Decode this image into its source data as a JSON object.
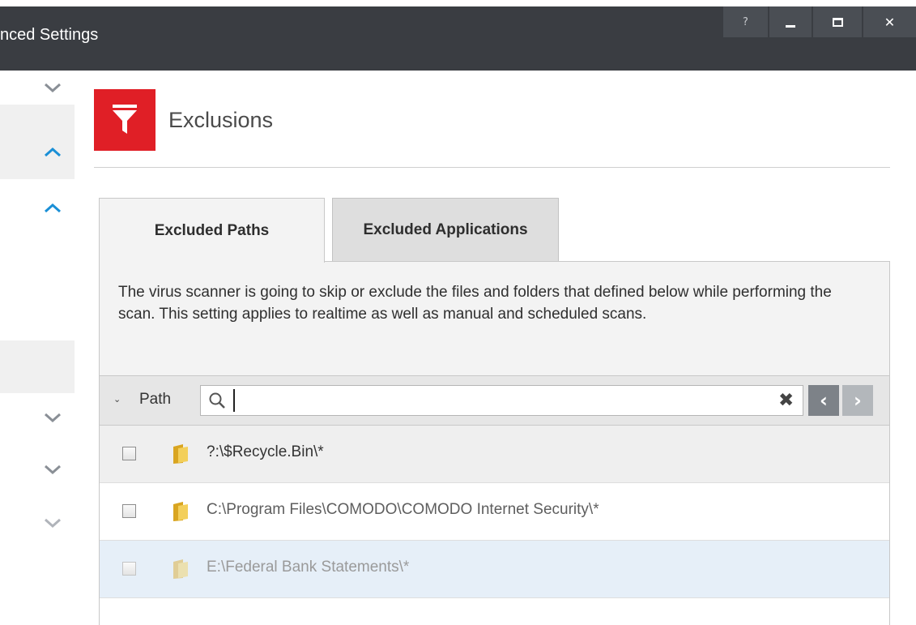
{
  "window": {
    "title": "nced Settings",
    "controls": {
      "help": "?",
      "close": "✕"
    }
  },
  "header": {
    "title": "Exclusions",
    "icon": "filter-icon",
    "accent_color": "#e01f26"
  },
  "tabs": [
    {
      "label": "Excluded Paths",
      "active": true
    },
    {
      "label": "Excluded Applications",
      "active": false
    }
  ],
  "description": "The virus scanner is going to skip or exclude the files and folders that defined below while performing the scan. This setting applies to realtime as well as manual and scheduled scans.",
  "filter": {
    "label": "Path",
    "search_value": "",
    "clear_icon": "✖",
    "prev_icon": "‹",
    "next_icon": "›"
  },
  "rows": [
    {
      "path": "?:\\$Recycle.Bin\\*",
      "checked": false,
      "state": "selected"
    },
    {
      "path": "C:\\Program Files\\COMODO\\COMODO Internet Security\\*",
      "checked": false,
      "state": "normal"
    },
    {
      "path": "E:\\Federal Bank Statements\\*",
      "checked": false,
      "state": "disabled"
    }
  ],
  "sidebar": {
    "items": [
      {
        "icon": "chevron-down-icon",
        "color": "#8a8f96"
      },
      {
        "icon": "chevron-up-icon",
        "color": "#1a8fd6"
      },
      {
        "icon": "chevron-up-icon",
        "color": "#1a8fd6"
      },
      {
        "icon": "chevron-down-icon",
        "color": "#8a8f96"
      },
      {
        "icon": "chevron-down-icon",
        "color": "#8a8f96"
      },
      {
        "icon": "chevron-down-icon",
        "color": "#b0b4ba"
      }
    ]
  }
}
